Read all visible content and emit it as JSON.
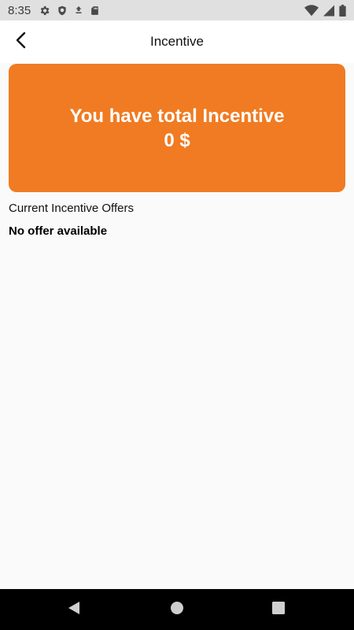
{
  "status_bar": {
    "time": "8:35",
    "icons_left": [
      "settings-icon",
      "shield-icon",
      "download-icon",
      "sd-card-icon"
    ],
    "icons_right": [
      "wifi-icon",
      "signal-icon",
      "battery-icon"
    ]
  },
  "app_bar": {
    "title": "Incentive",
    "back_icon": "arrow-back-icon"
  },
  "incentive_card": {
    "heading": "You have total Incentive",
    "amount": "0 $",
    "color": "#f07b22"
  },
  "offers": {
    "section_title": "Current Incentive Offers",
    "empty_message": "No offer available"
  },
  "nav_bar": {
    "buttons": [
      "back-triangle-icon",
      "home-circle-icon",
      "recents-square-icon"
    ]
  }
}
